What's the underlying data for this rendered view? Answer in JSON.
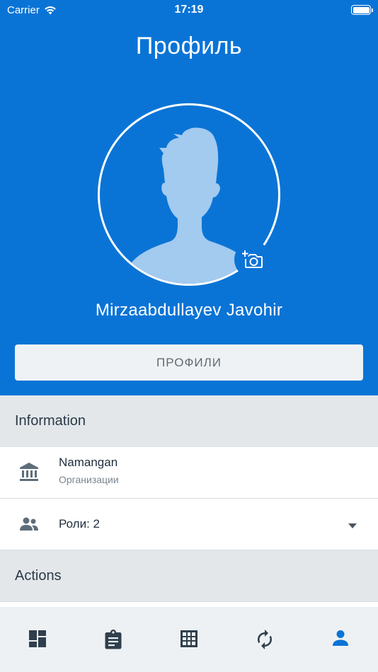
{
  "status_bar": {
    "carrier": "Carrier",
    "time": "17:19"
  },
  "header": {
    "title": "Профиль"
  },
  "profile": {
    "name": "Mirzaabdullayev Javohir",
    "button_label": "ПРОФИЛИ"
  },
  "sections": {
    "information": "Information",
    "actions": "Actions"
  },
  "info_rows": {
    "organization": {
      "title": "Namangan",
      "subtitle": "Организации",
      "icon": "bank-icon"
    },
    "roles": {
      "title": "Роли: 2",
      "icon": "people-icon"
    }
  },
  "tab_bar": {
    "tabs": [
      {
        "icon": "dashboard-icon"
      },
      {
        "icon": "clipboard-icon"
      },
      {
        "icon": "grid-icon"
      },
      {
        "icon": "sync-icon"
      },
      {
        "icon": "person-icon"
      }
    ],
    "active_index": 4
  },
  "colors": {
    "primary": "#0a74d6",
    "section_bg": "#e3e7ea",
    "tab_inactive": "#2f3f4d",
    "tab_active": "#0a74d6"
  }
}
